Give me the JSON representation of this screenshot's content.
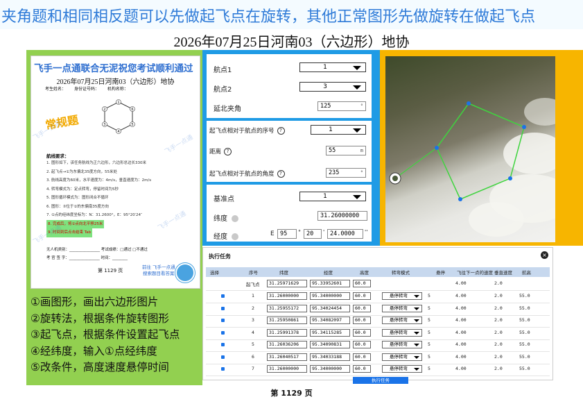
{
  "banner": {
    "text": "夹角题和相同相反题可以先做起飞点在旋转，其他正常图形先做旋转在做起飞点"
  },
  "title": "2026年07月25日河南03（六边形）地协",
  "document": {
    "header": "飞手一点通联合无泥祝您考试顺利通过",
    "subtitle": "2026年07月25日河南03（六边形）地协",
    "row_labels": [
      "考生姓名：",
      "身份证号码：",
      "机构名称："
    ],
    "stamp": "常规题",
    "hex_labels": [
      "1",
      "2",
      "3",
      "4",
      "5",
      "6"
    ],
    "req_title": "航线要求：",
    "requirements": [
      "1. 图形如下，该任务航线为正六边形，六边形总边长330米",
      "2. 起飞点→①为东偏北35度方向，55米处",
      "3. 航线高度为60米，水平速度为：4m/s，垂直速度为：2m/s",
      "4. 转弯模式为：定点转弯，停留时间为5秒",
      "5. 图形循环模式为：图形闭合不循环",
      "6. 图形：③位于①的东偏南35度方向",
      "7. ①点的经纬度坐标为：N：31.2600°，E：95°20′24″"
    ],
    "highlights": [
      "8. 完成后，将①点向北平移25米",
      "9. 时间到后点击结束 Tab"
    ],
    "sign_rows": [
      "无人机类别：________________  考试成绩：□通过 □不通过",
      "考 官 签 字：________________  时间：________"
    ],
    "footer": "第 1129 页",
    "link": [
      "前往 飞手一点通",
      "搜索题目看答案"
    ],
    "watermark": "飞手一点通"
  },
  "steps": [
    "①画图形，画出六边形图片",
    "②旋转法，根据条件旋转图形",
    "③起飞点，根据条件设置起飞点",
    "④经纬度，输入①点经纬度",
    "⑤改条件，高度速度悬停时间"
  ],
  "form": {
    "waypoint1_label": "航点1",
    "waypoint1_value": "1",
    "waypoint2_label": "航点2",
    "waypoint2_value": "3",
    "north_angle_label": "延北夹角",
    "north_angle_value": "125",
    "takeoff_seq_label": "起飞点相对于航点的序号",
    "takeoff_seq_value": "1",
    "distance_label": "距离",
    "distance_value": "55",
    "distance_unit": "m",
    "takeoff_angle_label": "起飞点相对于航点的角度",
    "takeoff_angle_value": "235",
    "base_label": "基准点",
    "base_value": "1",
    "lat_label": "纬度",
    "lat_value": "31.26000000",
    "lon_label": "经度",
    "lon_prefix": "E",
    "lon_deg": "95",
    "lon_min": "20",
    "lon_sec": "24.0000",
    "deg_symbol": "°",
    "min_symbol": "'",
    "sec_symbol": "''",
    "angle_unit": "°"
  },
  "table": {
    "title": "执行任务",
    "close": "×",
    "headers": [
      "选择",
      "序号",
      "纬度",
      "经度",
      "高度",
      "转弯模式",
      "悬停",
      "飞往下一点的速度",
      "垂直速度",
      "航高"
    ],
    "takeoff": {
      "seq": "起飞点",
      "lat": "31.25971629",
      "lon": "95.33952601",
      "alt": "60.0",
      "speed": "4.00",
      "vspeed": "2.0"
    },
    "rows": [
      {
        "seq": "1",
        "lat": "31.26000000",
        "lon": "95.34000000",
        "alt": "60.0",
        "mode": "悬停转弯",
        "hover": "5",
        "speed": "4.00",
        "vspeed": "2.0",
        "height": "55.0"
      },
      {
        "seq": "2",
        "lat": "31.25955172",
        "lon": "95.34024454",
        "alt": "60.0",
        "mode": "悬停转弯",
        "hover": "5",
        "speed": "4.00",
        "vspeed": "2.0",
        "height": "55.0"
      },
      {
        "seq": "3",
        "lat": "31.25950861",
        "lon": "95.34082097",
        "alt": "60.0",
        "mode": "悬停转弯",
        "hover": "5",
        "speed": "4.00",
        "vspeed": "2.0",
        "height": "55.0"
      },
      {
        "seq": "4",
        "lat": "31.25991378",
        "lon": "95.34115285",
        "alt": "60.0",
        "mode": "悬停转弯",
        "hover": "5",
        "speed": "4.00",
        "vspeed": "2.0",
        "height": "55.0"
      },
      {
        "seq": "5",
        "lat": "31.26036206",
        "lon": "95.34090831",
        "alt": "60.0",
        "mode": "悬停转弯",
        "hover": "5",
        "speed": "4.00",
        "vspeed": "2.0",
        "height": "55.0"
      },
      {
        "seq": "6",
        "lat": "31.26040517",
        "lon": "95.34033188",
        "alt": "60.0",
        "mode": "悬停转弯",
        "hover": "5",
        "speed": "4.00",
        "vspeed": "2.0",
        "height": "55.0"
      },
      {
        "seq": "7",
        "lat": "31.26000000",
        "lon": "95.34000000",
        "alt": "60.0",
        "mode": "悬停转弯",
        "hover": "5",
        "speed": "4.00",
        "vspeed": "2.0",
        "height": "55.0"
      }
    ],
    "exec_button": "执行任务"
  },
  "page_number": "第 1129 页",
  "colors": {
    "banner_text": "#2f7bd8",
    "green": "#92d050",
    "blue": "#1f9be5",
    "orange": "#f7b500",
    "accent": "#1a73e8"
  }
}
